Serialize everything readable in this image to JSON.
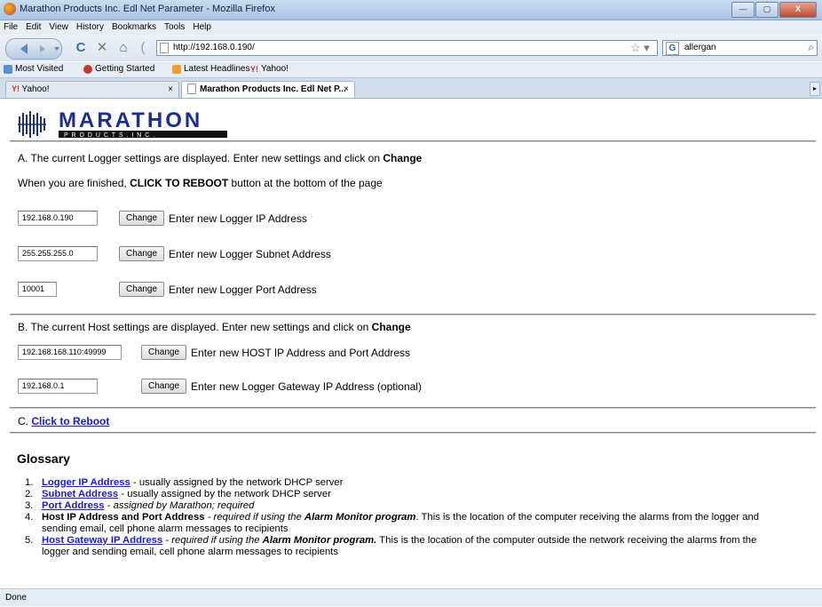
{
  "window": {
    "title": "Marathon Products Inc. Edl Net Parameter - Mozilla Firefox",
    "min": "—",
    "max": "▢",
    "close": "X"
  },
  "menu": [
    "File",
    "Edit",
    "View",
    "History",
    "Bookmarks",
    "Tools",
    "Help"
  ],
  "nav": {
    "url": "http://192.168.0.190/",
    "search": "allergan",
    "star": "☆ ▾",
    "engine": "G"
  },
  "bookmarks": [
    "Most Visited",
    "Getting Started",
    "Latest Headlines",
    "Yahoo!"
  ],
  "tabs": [
    {
      "label": "Yahoo!",
      "close": "×"
    },
    {
      "label": "Marathon Products Inc. Edl Net P...",
      "close": "×"
    }
  ],
  "logo": {
    "name": "MARATHON",
    "sub": "P R O D U C T S  .  I N C ."
  },
  "section_a": {
    "line1": "A. The current Logger settings are displayed. Enter new settings and click on ",
    "line1_bold": "Change",
    "line2": "When you are finished, ",
    "line2_bold": "CLICK TO REBOOT",
    "line2_end": " button at the bottom of the page",
    "rows": [
      {
        "value": "192.168.0.190",
        "button": "Change",
        "label": "Enter new Logger IP Address"
      },
      {
        "value": "255.255.255.0",
        "button": "Change",
        "label": "Enter new Logger Subnet Address"
      },
      {
        "value": "10001",
        "button": "Change",
        "label": "Enter new Logger Port Address"
      }
    ]
  },
  "section_b": {
    "line1": "B. The current Host settings are displayed. Enter new settings and click on ",
    "line1_bold": "Change",
    "rows": [
      {
        "value": "192.168.168.110:49999",
        "button": "Change",
        "label": "Enter new HOST IP Address and Port Address"
      },
      {
        "value": "192.168.0.1",
        "button": "Change",
        "label": "Enter new Logger Gateway IP Address (optional)"
      }
    ]
  },
  "section_c": {
    "prefix": "C. ",
    "link": "Click to Reboot"
  },
  "glossary": {
    "title": "Glossary",
    "items": [
      {
        "num": "1.",
        "term": "Logger IP Address",
        "desc": " - usually assigned by the network DHCP server"
      },
      {
        "num": "2.",
        "term": "Subnet Address",
        "desc": " - usually assigned by the network DHCP server"
      },
      {
        "num": "3.",
        "term": "Port Address",
        "desc_italic": " - assigned by Marathon; required"
      },
      {
        "num": "4.",
        "term": "Host IP Address and Port Address",
        "desc_italic": " - required if using the ",
        "desc_bold_italic": "Alarm Monitor program",
        "desc": ". This is the location of the computer receiving the alarms from the logger and",
        "cont": "sending email, cell phone alarm messages to recipients"
      },
      {
        "num": "5.",
        "term": "Host Gateway IP Address",
        "desc_italic": " - required if using the ",
        "desc_bold_italic": "Alarm Monitor program.",
        "desc": " This is the location of the computer outside the network receiving the alarms from the",
        "cont": "logger and sending email, cell phone alarm messages to recipients"
      }
    ]
  },
  "status": "Done"
}
